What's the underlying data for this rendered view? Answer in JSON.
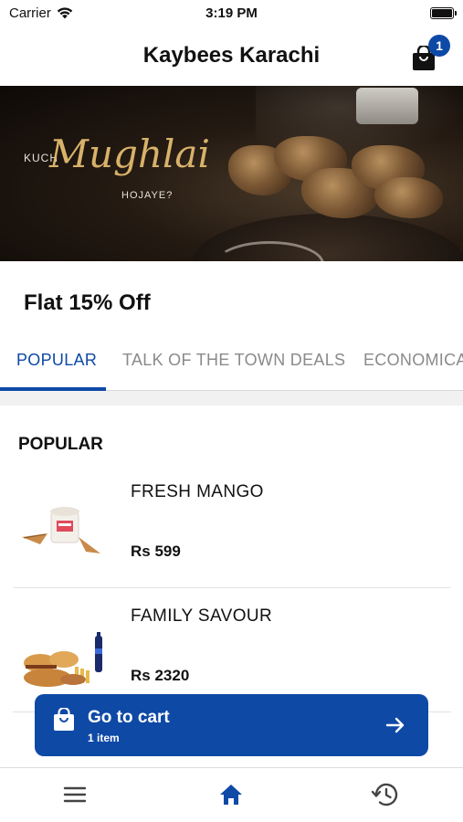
{
  "status_bar": {
    "carrier": "Carrier",
    "time": "3:19 PM"
  },
  "header": {
    "title": "Kaybees Karachi",
    "cart_count": "1"
  },
  "banner": {
    "line1": "KUCH",
    "line2": "Mughlai",
    "line3": "HOJAYE?"
  },
  "promo": {
    "text": "Flat 15% Off"
  },
  "tabs": [
    {
      "label": "POPULAR",
      "active": true
    },
    {
      "label": "TALK OF THE TOWN DEALS",
      "active": false
    },
    {
      "label": "ECONOMICA",
      "active": false
    }
  ],
  "section": {
    "title": "POPULAR"
  },
  "items": [
    {
      "name": "FRESH MANGO",
      "price": "Rs 599"
    },
    {
      "name": "FAMILY SAVOUR",
      "price": "Rs 2320"
    }
  ],
  "cart_bar": {
    "label": "Go to cart",
    "count": "1 item"
  },
  "bottom_nav": [
    "menu-icon",
    "home-icon",
    "history-icon"
  ],
  "colors": {
    "accent": "#0e49a6",
    "inactive": "#8a8a8a"
  }
}
